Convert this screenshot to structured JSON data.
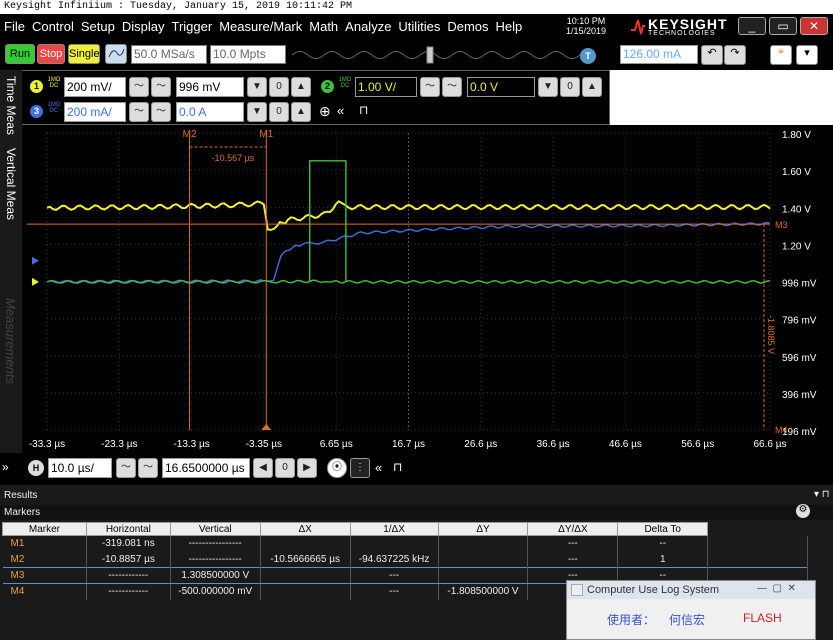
{
  "caption": "Keysight Infiniium : Tuesday, January 15, 2019 10:11:42 PM",
  "menu": [
    "File",
    "Control",
    "Setup",
    "Display",
    "Trigger",
    "Measure/Mark",
    "Math",
    "Analyze",
    "Utilities",
    "Demos",
    "Help"
  ],
  "datetime": {
    "time": "10:10 PM",
    "date": "1/15/2019"
  },
  "brand": {
    "name": "KEYSIGHT",
    "sub": "TECHNOLOGIES"
  },
  "toolbar": {
    "run": "Run",
    "stop": "Stop",
    "single": "Single",
    "sample_rate": "50.0 MSa/s",
    "memory": "10.0 Mpts",
    "trigger_level": "126.00 mA",
    "trigger_badge": "T"
  },
  "channels": {
    "ch1": {
      "num": "1",
      "coupling": "1MΩ\nDC",
      "scale": "200 mV/",
      "offset": "996 mV",
      "color": "#f0f030"
    },
    "ch2": {
      "num": "2",
      "coupling": "1MΩ\nDC",
      "scale": "1.00 V/",
      "offset": "0.0 V",
      "color": "#40c040"
    },
    "ch3": {
      "num": "3",
      "coupling": "1MΩ\nDC",
      "scale": "200 mA/",
      "offset": "0.0 A",
      "color": "#4070e0"
    }
  },
  "sidebar_tabs": [
    "Time Meas",
    "Vertical Meas"
  ],
  "measurements_watermark": "Measurements",
  "markers_labels": {
    "m1": "M1",
    "m2": "M2",
    "m3": "M3",
    "m4": "M4",
    "delta": "-10.567 µs",
    "dy": "-1.8085 V"
  },
  "chart_data": {
    "type": "line",
    "x_ticks": [
      "-33.3 µs",
      "-23.3 µs",
      "-13.3 µs",
      "-3.35 µs",
      "6.65 µs",
      "16.7 µs",
      "26.6 µs",
      "36.6 µs",
      "46.6 µs",
      "56.6 µs",
      "66.6 µs"
    ],
    "y_ticks": [
      "1.80 V",
      "1.60 V",
      "1.40 V",
      "1.20 V",
      "996 mV",
      "796 mV",
      "596 mV",
      "396 mV",
      "196 mV"
    ],
    "xlim": [
      -33.3,
      66.6
    ],
    "ylim": [
      196,
      1800
    ],
    "series": [
      {
        "color": "#f0f030",
        "x": [
          -33.3,
          -20,
          -8,
          -3.35,
          -2.8,
          -1.5,
          0,
          5,
          7,
          8,
          66.6
        ],
        "y": [
          1396,
          1400,
          1410,
          1420,
          1280,
          1300,
          1330,
          1360,
          1420,
          1400,
          1400
        ]
      },
      {
        "color": "#4070e0",
        "x": [
          -33.3,
          -3.35,
          -2,
          -1,
          0.5,
          2,
          5,
          10,
          20,
          30,
          50,
          66.6
        ],
        "y": [
          996,
          1000,
          1010,
          1140,
          1180,
          1200,
          1210,
          1260,
          1280,
          1295,
          1300,
          1310
        ]
      },
      {
        "color": "#40c040",
        "x": [
          -33.3,
          -3.35,
          -2,
          5,
          6,
          8,
          66.6
        ],
        "y": [
          996,
          996,
          996,
          1000,
          996,
          996,
          996
        ]
      }
    ]
  },
  "hbar": {
    "h_badge": "H",
    "scale": "10.0 µs/",
    "position": "16.6500000 µs"
  },
  "results": {
    "title": "Results",
    "tab": "Markers",
    "headers": [
      "Marker",
      "Horizontal",
      "Vertical",
      "ΔX",
      "1/ΔX",
      "ΔY",
      "ΔY/ΔX",
      "Delta To"
    ],
    "rows": [
      [
        "M1",
        "-319.081 ns",
        "----------------",
        "",
        "",
        "",
        "---",
        "--"
      ],
      [
        "M2",
        "-10.8857 µs",
        "----------------",
        "-10.5666665 µs",
        "-94.637225 kHz",
        "",
        "---",
        "1"
      ],
      [
        "M3",
        "------------",
        "1.308500000 V",
        "",
        "---",
        "",
        "---",
        "--"
      ],
      [
        "M4",
        "------------",
        "-500.000000 mV",
        "",
        "---",
        "-1.808500000 V",
        "---",
        "--"
      ]
    ]
  },
  "logwin": {
    "title": "Computer Use Log System",
    "user_label": "使用者：",
    "user": "何信宏",
    "status": "FLASH"
  }
}
